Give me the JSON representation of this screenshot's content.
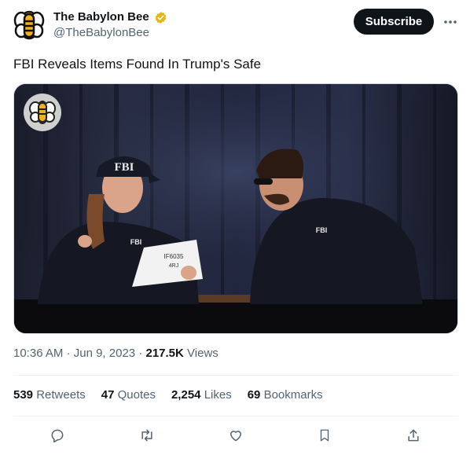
{
  "author": {
    "display_name": "The Babylon Bee",
    "handle": "@TheBabylonBee",
    "avatar_icon": "bee-logo-icon",
    "verified_badge": "gold-verified-badge-icon"
  },
  "header": {
    "subscribe_label": "Subscribe",
    "more_icon": "more-dots-icon"
  },
  "tweet": {
    "text": "FBI Reveals Items Found In Trump's Safe",
    "media": {
      "type": "video",
      "icon": "video-thumbnail",
      "watermark_icon": "bee-logo-watermark-icon",
      "text": {
        "cap_left": "FBI",
        "jacket_left": "FBI",
        "jacket_right": "FBI",
        "paper_line1": "IF6035",
        "paper_line2": "4RJ"
      }
    }
  },
  "meta": {
    "time": "10:36 AM",
    "date": "Jun 9, 2023",
    "views_count": "217.5K",
    "views_label": "Views",
    "sep": "·"
  },
  "stats": [
    {
      "count": "539",
      "label": "Retweets"
    },
    {
      "count": "47",
      "label": "Quotes"
    },
    {
      "count": "2,254",
      "label": "Likes"
    },
    {
      "count": "69",
      "label": "Bookmarks"
    }
  ],
  "actions": [
    "reply-icon",
    "retweet-icon",
    "like-icon",
    "bookmark-icon",
    "share-icon"
  ],
  "colors": {
    "text": "#0f1419",
    "secondary": "#536471",
    "divider": "#eff3f4",
    "badge_gold": "#e2b719",
    "bee_yellow": "#f4b023"
  }
}
